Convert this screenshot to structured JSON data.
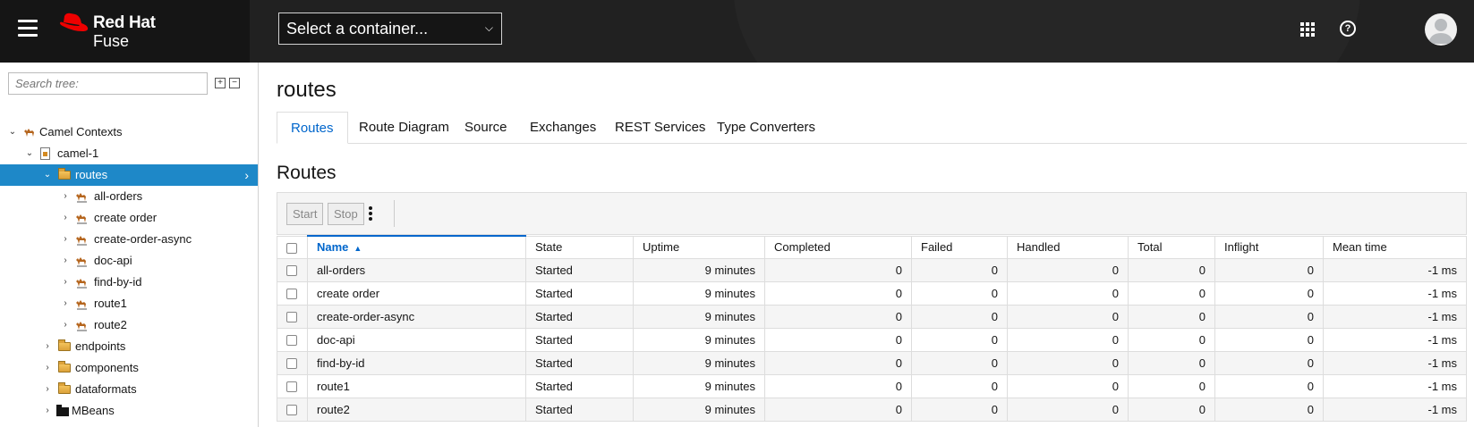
{
  "header": {
    "brand": "Red Hat",
    "product": "Fuse",
    "container_select": "Select a container..."
  },
  "sidebar": {
    "search_placeholder": "Search tree:",
    "expand_all": "+",
    "collapse_all": "−",
    "tree": {
      "root": "Camel Contexts",
      "context": "camel-1",
      "routes_folder": "routes",
      "routes": [
        "all-orders",
        "create order",
        "create-order-async",
        "doc-api",
        "find-by-id",
        "route1",
        "route2"
      ],
      "endpoints": "endpoints",
      "components": "components",
      "dataformats": "dataformats",
      "mbeans": "MBeans"
    }
  },
  "main": {
    "title": "routes",
    "tabs": [
      "Routes",
      "Route Diagram",
      "Source",
      "Exchanges",
      "REST Services",
      "Type Converters"
    ],
    "active_tab": "Routes",
    "section_title": "Routes",
    "toolbar": {
      "start": "Start",
      "stop": "Stop"
    },
    "table": {
      "columns": [
        "Name",
        "State",
        "Uptime",
        "Completed",
        "Failed",
        "Handled",
        "Total",
        "Inflight",
        "Mean time"
      ],
      "sorted_column": "Name",
      "rows": [
        [
          "all-orders",
          "Started",
          "9 minutes",
          "0",
          "0",
          "0",
          "0",
          "0",
          "-1 ms"
        ],
        [
          "create order",
          "Started",
          "9 minutes",
          "0",
          "0",
          "0",
          "0",
          "0",
          "-1 ms"
        ],
        [
          "create-order-async",
          "Started",
          "9 minutes",
          "0",
          "0",
          "0",
          "0",
          "0",
          "-1 ms"
        ],
        [
          "doc-api",
          "Started",
          "9 minutes",
          "0",
          "0",
          "0",
          "0",
          "0",
          "-1 ms"
        ],
        [
          "find-by-id",
          "Started",
          "9 minutes",
          "0",
          "0",
          "0",
          "0",
          "0",
          "-1 ms"
        ],
        [
          "route1",
          "Started",
          "9 minutes",
          "0",
          "0",
          "0",
          "0",
          "0",
          "-1 ms"
        ],
        [
          "route2",
          "Started",
          "9 minutes",
          "0",
          "0",
          "0",
          "0",
          "0",
          "-1 ms"
        ]
      ]
    }
  },
  "colors": {
    "selected": "#1e88c8",
    "link": "#0066cc",
    "brand_red": "#ee0000",
    "header_bg": "#212121"
  }
}
